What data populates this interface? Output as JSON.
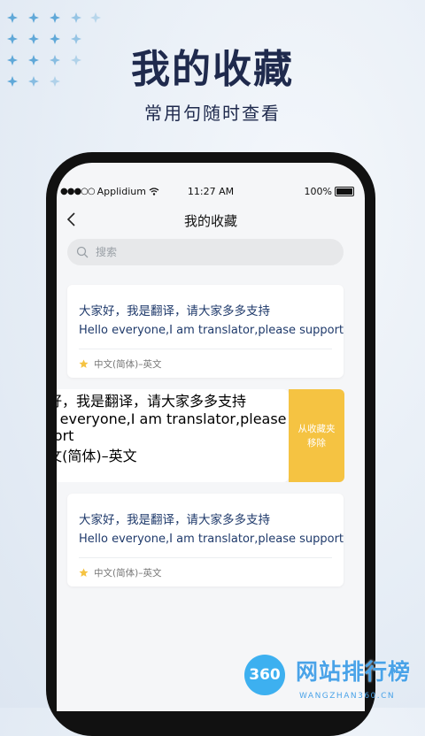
{
  "hero": {
    "title": "我的收藏",
    "subtitle": "常用句随时查看"
  },
  "status_bar": {
    "carrier": "Applidium",
    "time": "11:27 AM",
    "battery": "100%"
  },
  "nav": {
    "title": "我的收藏",
    "back_icon": "chevron-left-icon"
  },
  "search": {
    "placeholder": "搜索",
    "icon": "search-icon"
  },
  "favorites": [
    {
      "zh": "大家好，我是翻译，请大家多多支持",
      "en": "Hello everyone,I am translator,please support",
      "lang": "中文(简体)–英文"
    },
    {
      "zh": "大家好，我是翻译，请大家多多支持",
      "en": "Hello everyone,I am translator,please support",
      "lang": "中文(简体)–英文",
      "swiped": true
    },
    {
      "zh": "大家好，我是翻译，请大家多多支持",
      "en": "Hello everyone,I am translator,please support",
      "lang": "中文(简体)–英文"
    }
  ],
  "swipe_action": {
    "line1": "从收藏夹",
    "line2": "移除"
  },
  "watermark": {
    "badge": "360",
    "text": "网站排行榜",
    "url": "WANGZHAN360.CN"
  },
  "colors": {
    "accent": "#f5c342",
    "text": "#1f3a6b",
    "hero": "#1f2a4d",
    "watermark": "#4aa3e8"
  }
}
